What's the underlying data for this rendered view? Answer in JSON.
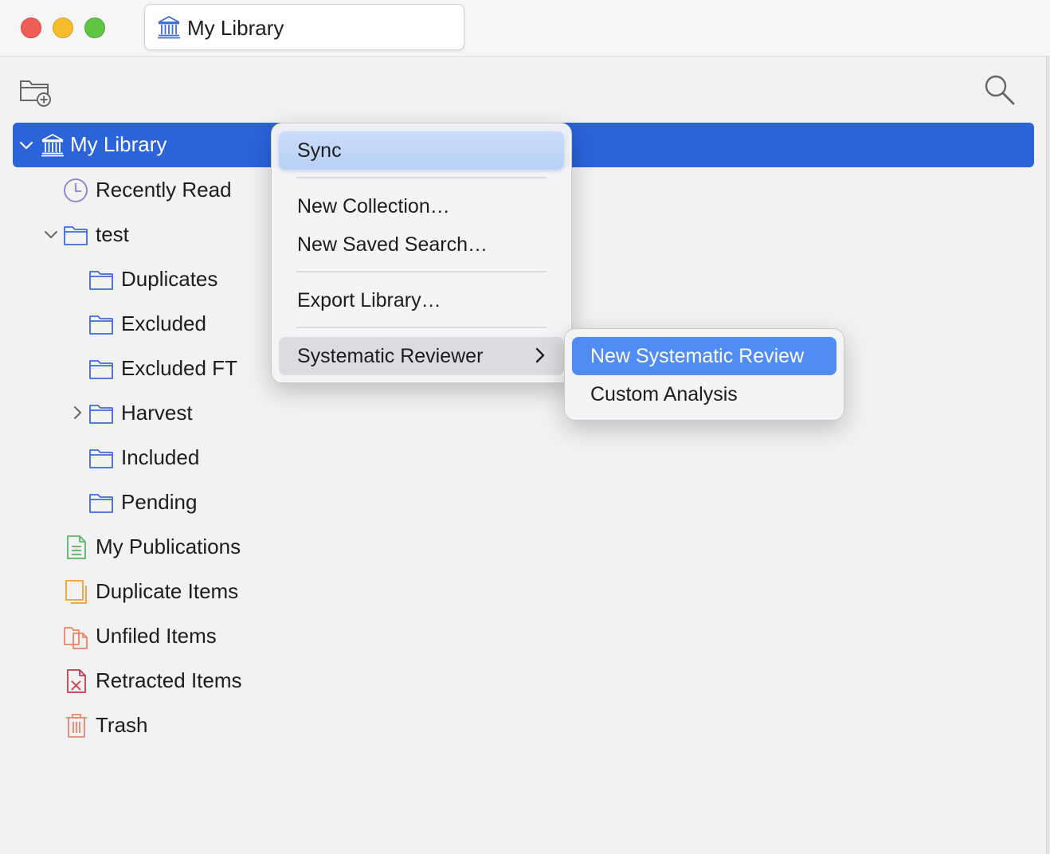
{
  "window": {
    "tab_title": "My Library"
  },
  "toolbar": {
    "new_collection_icon": "folder-plus-icon",
    "search_icon": "magnifier-icon"
  },
  "colors": {
    "selection": "#2b63d9",
    "folder_icon": "#3f6bd6",
    "submenu_highlight": "#4f8cf3"
  },
  "tree": {
    "library": {
      "label": "My Library",
      "icon": "library-icon"
    },
    "items": [
      {
        "label": "Recently Read",
        "icon": "clock-icon"
      },
      {
        "label": "test",
        "icon": "folder-icon"
      },
      {
        "label": "Duplicates",
        "icon": "folder-icon"
      },
      {
        "label": "Excluded",
        "icon": "folder-icon"
      },
      {
        "label": "Excluded FT",
        "icon": "folder-icon"
      },
      {
        "label": "Harvest",
        "icon": "folder-icon"
      },
      {
        "label": "Included",
        "icon": "folder-icon"
      },
      {
        "label": "Pending",
        "icon": "folder-icon"
      },
      {
        "label": "My Publications",
        "icon": "document-icon"
      },
      {
        "label": "Duplicate Items",
        "icon": "duplicate-icon"
      },
      {
        "label": "Unfiled Items",
        "icon": "unfiled-icon"
      },
      {
        "label": "Retracted Items",
        "icon": "retracted-icon"
      },
      {
        "label": "Trash",
        "icon": "trash-icon"
      }
    ]
  },
  "context_menu": {
    "items": [
      {
        "label": "Sync"
      },
      {
        "label": "New Collection…"
      },
      {
        "label": "New Saved Search…"
      },
      {
        "label": "Export Library…"
      },
      {
        "label": "Systematic Reviewer"
      }
    ]
  },
  "submenu": {
    "items": [
      {
        "label": "New Systematic Review"
      },
      {
        "label": "Custom Analysis"
      }
    ]
  }
}
